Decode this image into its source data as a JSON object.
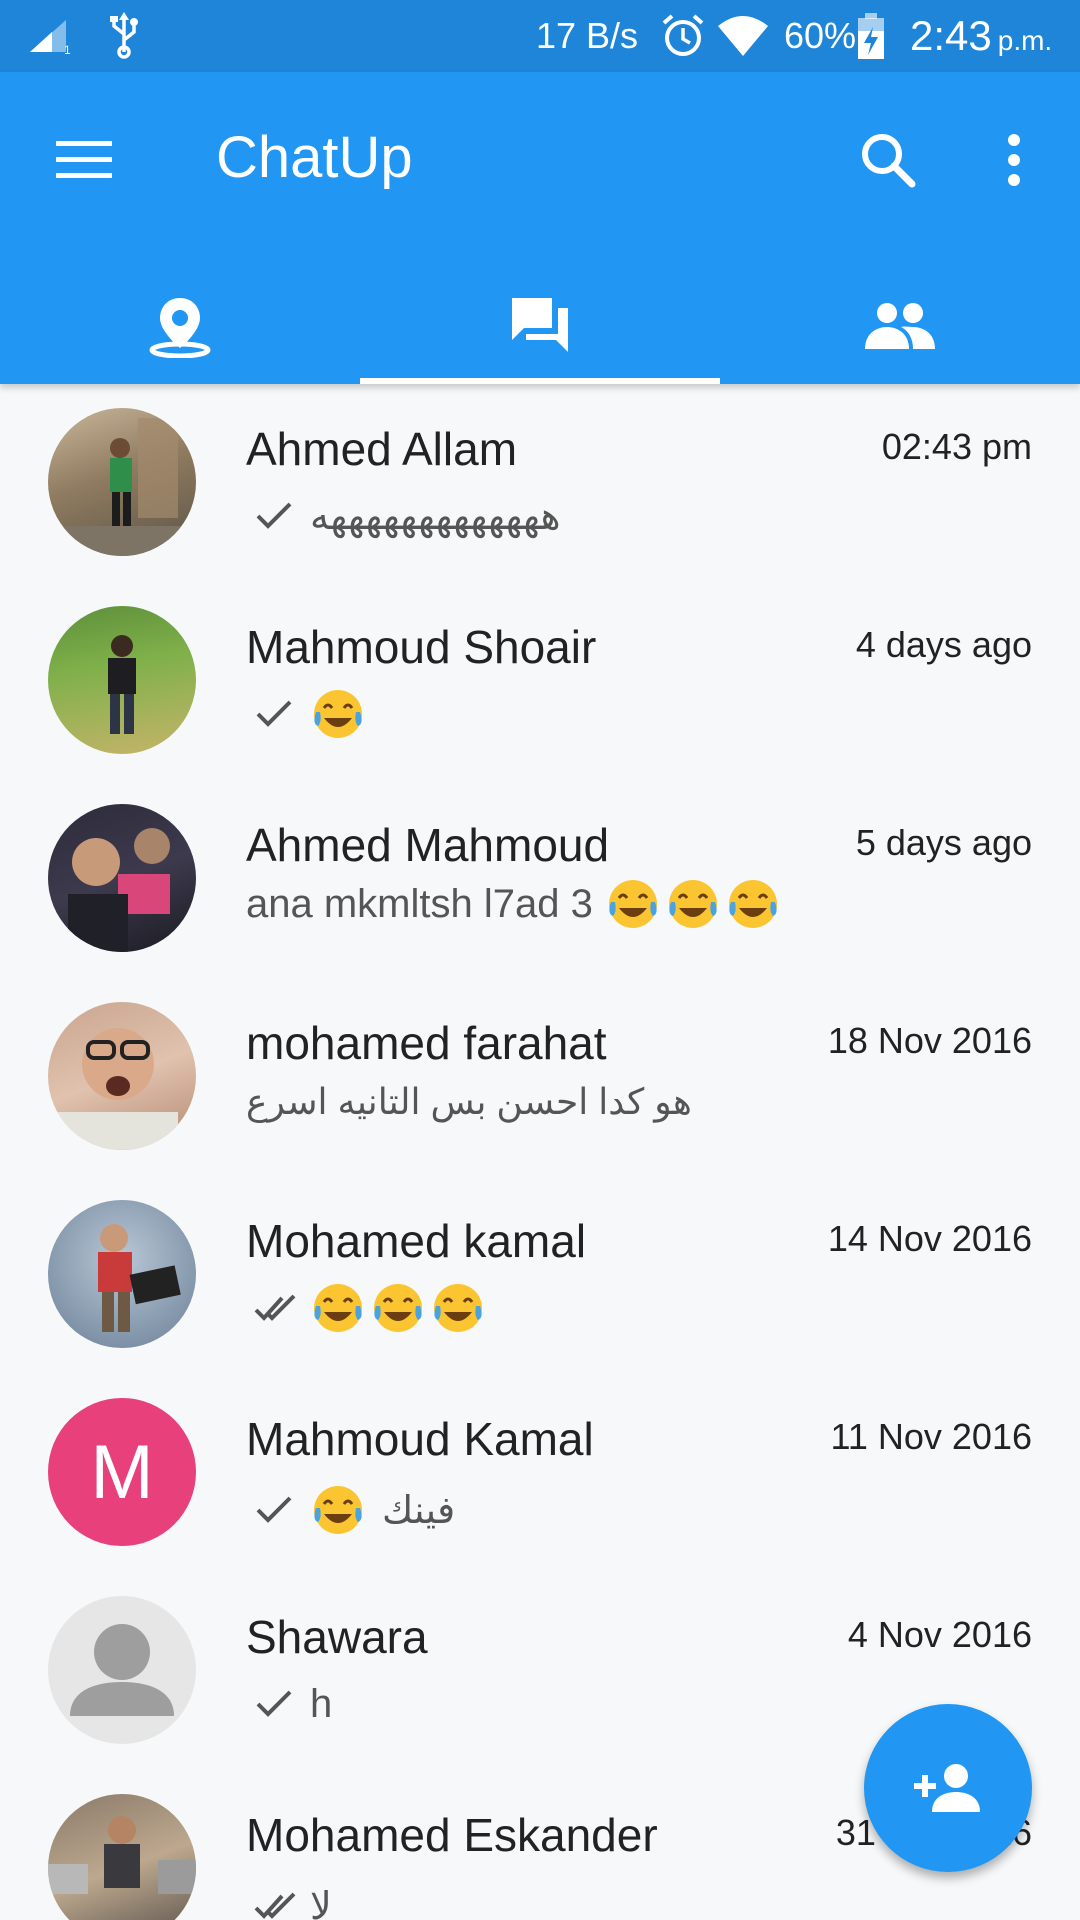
{
  "status_bar": {
    "network_speed": "17 B/s",
    "battery": "60%",
    "time": "2:43",
    "ampm": "p.m.",
    "icons": [
      "signal-icon",
      "usb-icon",
      "alarm-icon",
      "wifi-icon",
      "battery-charging-icon"
    ]
  },
  "app_bar": {
    "title": "ChatUp",
    "menu_icon": "hamburger-menu-icon",
    "search_icon": "search-icon",
    "more_icon": "more-vert-icon"
  },
  "tabs": [
    {
      "icon": "location-pin-icon",
      "selected": false
    },
    {
      "icon": "chat-bubbles-icon",
      "selected": true
    },
    {
      "icon": "people-icon",
      "selected": false
    }
  ],
  "colors": {
    "primary": "#2196f3",
    "primary_dark": "#1f85d9",
    "background": "#f7f8f9",
    "text_primary": "#222222",
    "text_secondary": "#555555",
    "avatar_m": "#e8407a"
  },
  "conversations": [
    {
      "name": "Ahmed Allam",
      "time": "02:43 pm",
      "status": "sent",
      "text": "هههههههههههههه",
      "emoji_count": 0
    },
    {
      "name": "Mahmoud Shoair",
      "time": "4 days ago",
      "status": "sent",
      "text": "",
      "emoji_count": 1
    },
    {
      "name": "Ahmed Mahmoud",
      "time": "5 days ago",
      "status": "none",
      "text": "ana mkmltsh l7ad 3",
      "emoji_count": 3
    },
    {
      "name": "mohamed farahat",
      "time": "18 Nov 2016",
      "status": "none",
      "text": "هو كدا احسن بس التانيه اسرع",
      "emoji_count": 0
    },
    {
      "name": "Mohamed kamal",
      "time": "14 Nov 2016",
      "status": "read",
      "text": "",
      "emoji_count": 3
    },
    {
      "name": "Mahmoud Kamal",
      "time": "11 Nov 2016",
      "status": "sent",
      "text": "فينك",
      "emoji_count": 1,
      "avatar_letter": "M"
    },
    {
      "name": "Shawara",
      "time": "4 Nov 2016",
      "status": "sent",
      "text": "h",
      "emoji_count": 0
    },
    {
      "name": "Mohamed Eskander",
      "time": "31 Oct 2016",
      "status": "read",
      "text": "لا",
      "emoji_count": 0
    }
  ],
  "fab": {
    "icon": "add-person-icon"
  }
}
